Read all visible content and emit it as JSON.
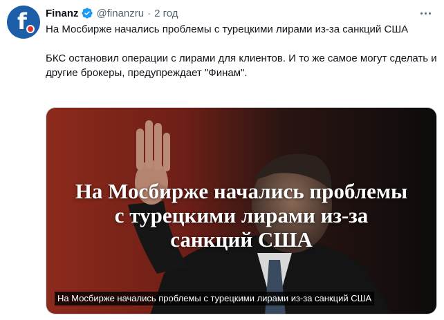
{
  "author": {
    "display_name": "Finanz",
    "handle": "@finanzru",
    "separator": "·",
    "time": "2 год",
    "avatar_letter": "f",
    "verified_color": "#1d9bf0",
    "avatar_color": "#1d5ea8",
    "avatar_dot_color": "#e0312e"
  },
  "tweet": {
    "paragraph1": "На Мосбирже начались проблемы с турецкими лирами из-за санкций США",
    "paragraph2": "БКС остановил операции с лирами для клиентов. И то же самое могут сделать и другие брокеры, предупреждает \"Финам\"."
  },
  "media": {
    "headline_line1": "На Мосбирже начались проблемы",
    "headline_line2": "с турецкими лирами из-за",
    "headline_line3": "санкций США",
    "caption": "На Мосбирже начались проблемы с турецкими лирами из-за санкций США"
  },
  "icons": {
    "verified": "verified-badge-icon",
    "more": "more-options-icon"
  }
}
